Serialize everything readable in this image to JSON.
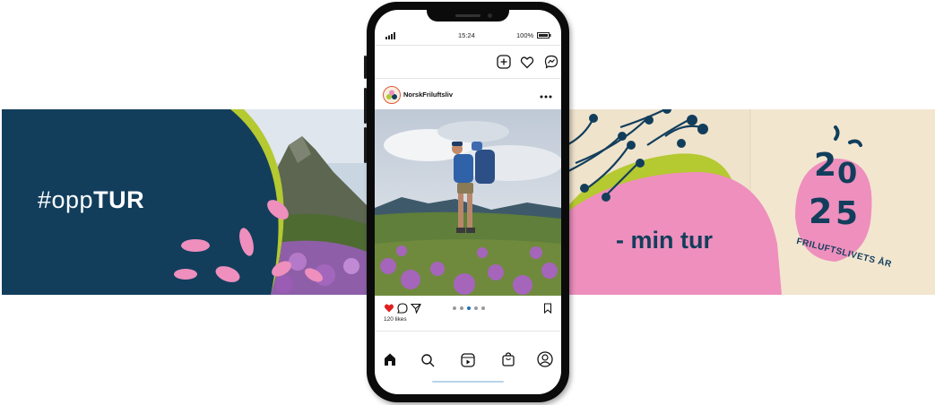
{
  "left_banner": {
    "hashtag_prefix": "#opp",
    "hashtag_bold": "TUR"
  },
  "right_banner": {
    "tagline": "- min tur",
    "logo_number": "2025",
    "logo_digits": [
      "2",
      "0",
      "2",
      "5"
    ],
    "logo_text": "FRILUFTSLIVETS ÅR"
  },
  "phone": {
    "status_bar": {
      "time": "15:24",
      "battery": "100%"
    },
    "header_icons": [
      "add-post-icon",
      "heart-icon",
      "messenger-icon"
    ],
    "post": {
      "account_name": "NorskFriluftsliv",
      "likes": "120 likes",
      "carousel_dots": 5,
      "active_dot": 3
    },
    "bottom_nav": [
      "home-icon",
      "search-icon",
      "reels-icon",
      "shop-icon",
      "profile-icon"
    ]
  },
  "colors": {
    "navy": "#123e5c",
    "lime": "#b5c930",
    "pink": "#ee8fbd",
    "cream": "#f2e6cf",
    "like_red": "#e02020"
  }
}
